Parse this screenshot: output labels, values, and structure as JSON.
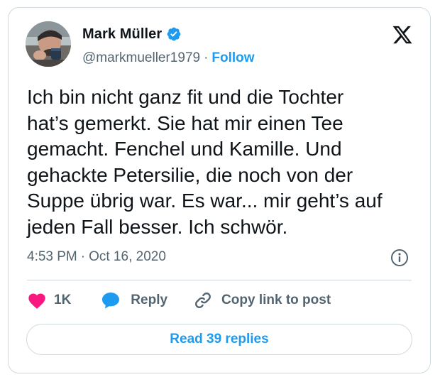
{
  "author": {
    "display_name": "Mark Müller",
    "handle": "@markmueller1979",
    "separator": "·",
    "follow_label": "Follow"
  },
  "tweet": {
    "text": "Ich bin nicht ganz fit und die Tochter\nhat’s gemerkt. Sie hat mir einen Tee\ngemacht. Fenchel und Kamille. Und\ngehackte Petersilie, die noch von der\nSuppe übrig war. Es war... mir geht’s auf\njeden Fall besser. Ich schwör.",
    "time": "4:53 PM",
    "date_separator": "·",
    "date": "Oct 16, 2020"
  },
  "actions": {
    "like_count": "1K",
    "reply_label": "Reply",
    "copy_link_label": "Copy link to post"
  },
  "read_replies_label": "Read 39 replies",
  "colors": {
    "accent": "#1d9bf0",
    "like": "#f91880",
    "text": "#0f1419",
    "muted": "#536471",
    "border": "#cfd9de"
  },
  "icons": [
    "avatar-photo",
    "verified-badge-icon",
    "x-logo-icon",
    "info-icon",
    "heart-icon",
    "reply-bubble-icon",
    "link-icon"
  ]
}
